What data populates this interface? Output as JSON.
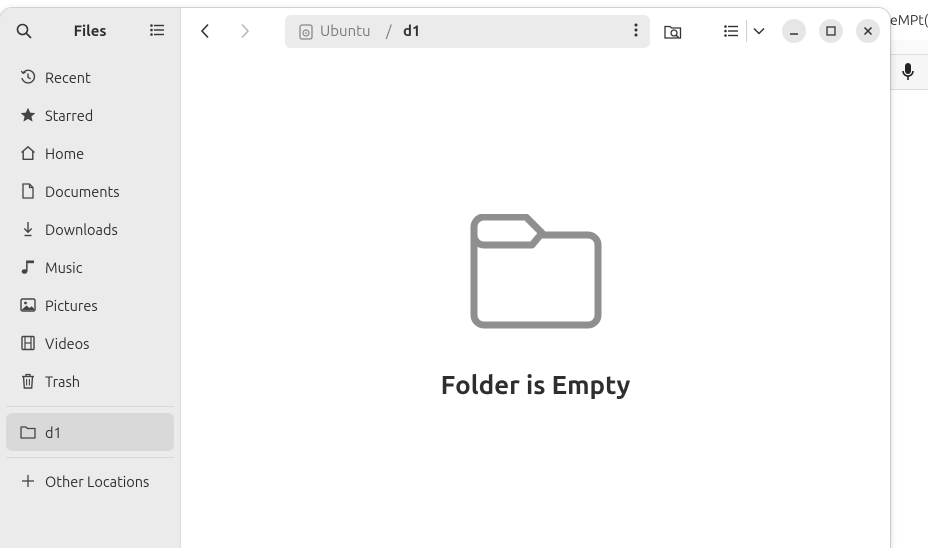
{
  "background_window": {
    "visible_text": "eMPt("
  },
  "sidebar": {
    "title": "Files",
    "items": [
      {
        "label": "Recent",
        "icon": "clock-icon"
      },
      {
        "label": "Starred",
        "icon": "star-icon"
      },
      {
        "label": "Home",
        "icon": "home-icon"
      },
      {
        "label": "Documents",
        "icon": "document-icon"
      },
      {
        "label": "Downloads",
        "icon": "download-icon"
      },
      {
        "label": "Music",
        "icon": "music-note-icon"
      },
      {
        "label": "Pictures",
        "icon": "picture-icon"
      },
      {
        "label": "Videos",
        "icon": "film-icon"
      },
      {
        "label": "Trash",
        "icon": "trash-icon"
      }
    ],
    "bookmarks": [
      {
        "label": "d1",
        "icon": "folder-icon",
        "active": true
      }
    ],
    "other_locations": {
      "label": "Other Locations",
      "icon": "plus-icon"
    }
  },
  "path": {
    "drive": "Ubuntu",
    "separator": "/",
    "current": "d1"
  },
  "empty_state": {
    "message": "Folder is Empty",
    "icon": "folder-outline-icon"
  },
  "colors": {
    "sidebar_bg": "#ebebeb",
    "active_item_bg": "#d9d9d9",
    "empty_icon": "#8f8f8f"
  }
}
